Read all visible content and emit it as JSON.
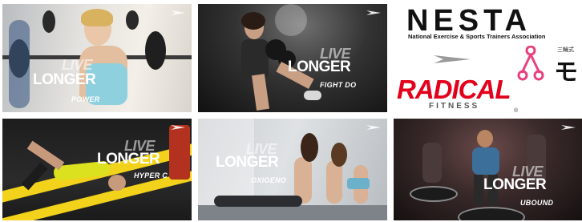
{
  "tiles": [
    {
      "live": "LIVE",
      "longer": "LONGER",
      "label": "POWER"
    },
    {
      "live": "LIVE",
      "longer": "LONGER",
      "label": "FIGHT DO"
    },
    {
      "live": "LIVE",
      "longer": "LONGER",
      "label": "HYPER C"
    },
    {
      "live": "LIVE",
      "longer": "LONGER",
      "label": "OXIGENO"
    },
    {
      "live": "LIVE",
      "longer": "LONGER",
      "label": "UBOUND"
    }
  ],
  "logos": {
    "nesta": "NESTA",
    "nesta_sub": "National Exercise & Sports Trainers Association",
    "radical": "RADICAL",
    "radical_sub": "FITNESS",
    "registered": "®",
    "jp_text": "三輪式",
    "jp_letter": "モ"
  },
  "colors": {
    "radical_red": "#e3001b",
    "nesta_black": "#111111",
    "pink": "#e8417f",
    "yellow": "#f2d21a"
  }
}
